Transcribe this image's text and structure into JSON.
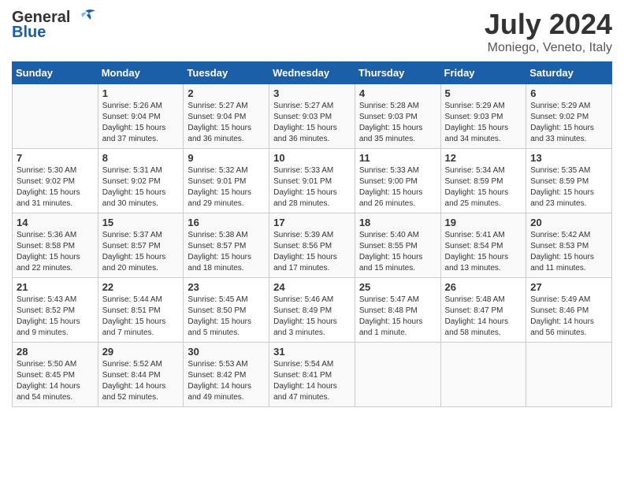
{
  "header": {
    "logo_general": "General",
    "logo_blue": "Blue",
    "month": "July 2024",
    "location": "Moniego, Veneto, Italy"
  },
  "weekdays": [
    "Sunday",
    "Monday",
    "Tuesday",
    "Wednesday",
    "Thursday",
    "Friday",
    "Saturday"
  ],
  "weeks": [
    [
      {
        "day": "",
        "sunrise": "",
        "sunset": "",
        "daylight": ""
      },
      {
        "day": "1",
        "sunrise": "Sunrise: 5:26 AM",
        "sunset": "Sunset: 9:04 PM",
        "daylight": "Daylight: 15 hours and 37 minutes."
      },
      {
        "day": "2",
        "sunrise": "Sunrise: 5:27 AM",
        "sunset": "Sunset: 9:04 PM",
        "daylight": "Daylight: 15 hours and 36 minutes."
      },
      {
        "day": "3",
        "sunrise": "Sunrise: 5:27 AM",
        "sunset": "Sunset: 9:03 PM",
        "daylight": "Daylight: 15 hours and 36 minutes."
      },
      {
        "day": "4",
        "sunrise": "Sunrise: 5:28 AM",
        "sunset": "Sunset: 9:03 PM",
        "daylight": "Daylight: 15 hours and 35 minutes."
      },
      {
        "day": "5",
        "sunrise": "Sunrise: 5:29 AM",
        "sunset": "Sunset: 9:03 PM",
        "daylight": "Daylight: 15 hours and 34 minutes."
      },
      {
        "day": "6",
        "sunrise": "Sunrise: 5:29 AM",
        "sunset": "Sunset: 9:02 PM",
        "daylight": "Daylight: 15 hours and 33 minutes."
      }
    ],
    [
      {
        "day": "7",
        "sunrise": "Sunrise: 5:30 AM",
        "sunset": "Sunset: 9:02 PM",
        "daylight": "Daylight: 15 hours and 31 minutes."
      },
      {
        "day": "8",
        "sunrise": "Sunrise: 5:31 AM",
        "sunset": "Sunset: 9:02 PM",
        "daylight": "Daylight: 15 hours and 30 minutes."
      },
      {
        "day": "9",
        "sunrise": "Sunrise: 5:32 AM",
        "sunset": "Sunset: 9:01 PM",
        "daylight": "Daylight: 15 hours and 29 minutes."
      },
      {
        "day": "10",
        "sunrise": "Sunrise: 5:33 AM",
        "sunset": "Sunset: 9:01 PM",
        "daylight": "Daylight: 15 hours and 28 minutes."
      },
      {
        "day": "11",
        "sunrise": "Sunrise: 5:33 AM",
        "sunset": "Sunset: 9:00 PM",
        "daylight": "Daylight: 15 hours and 26 minutes."
      },
      {
        "day": "12",
        "sunrise": "Sunrise: 5:34 AM",
        "sunset": "Sunset: 8:59 PM",
        "daylight": "Daylight: 15 hours and 25 minutes."
      },
      {
        "day": "13",
        "sunrise": "Sunrise: 5:35 AM",
        "sunset": "Sunset: 8:59 PM",
        "daylight": "Daylight: 15 hours and 23 minutes."
      }
    ],
    [
      {
        "day": "14",
        "sunrise": "Sunrise: 5:36 AM",
        "sunset": "Sunset: 8:58 PM",
        "daylight": "Daylight: 15 hours and 22 minutes."
      },
      {
        "day": "15",
        "sunrise": "Sunrise: 5:37 AM",
        "sunset": "Sunset: 8:57 PM",
        "daylight": "Daylight: 15 hours and 20 minutes."
      },
      {
        "day": "16",
        "sunrise": "Sunrise: 5:38 AM",
        "sunset": "Sunset: 8:57 PM",
        "daylight": "Daylight: 15 hours and 18 minutes."
      },
      {
        "day": "17",
        "sunrise": "Sunrise: 5:39 AM",
        "sunset": "Sunset: 8:56 PM",
        "daylight": "Daylight: 15 hours and 17 minutes."
      },
      {
        "day": "18",
        "sunrise": "Sunrise: 5:40 AM",
        "sunset": "Sunset: 8:55 PM",
        "daylight": "Daylight: 15 hours and 15 minutes."
      },
      {
        "day": "19",
        "sunrise": "Sunrise: 5:41 AM",
        "sunset": "Sunset: 8:54 PM",
        "daylight": "Daylight: 15 hours and 13 minutes."
      },
      {
        "day": "20",
        "sunrise": "Sunrise: 5:42 AM",
        "sunset": "Sunset: 8:53 PM",
        "daylight": "Daylight: 15 hours and 11 minutes."
      }
    ],
    [
      {
        "day": "21",
        "sunrise": "Sunrise: 5:43 AM",
        "sunset": "Sunset: 8:52 PM",
        "daylight": "Daylight: 15 hours and 9 minutes."
      },
      {
        "day": "22",
        "sunrise": "Sunrise: 5:44 AM",
        "sunset": "Sunset: 8:51 PM",
        "daylight": "Daylight: 15 hours and 7 minutes."
      },
      {
        "day": "23",
        "sunrise": "Sunrise: 5:45 AM",
        "sunset": "Sunset: 8:50 PM",
        "daylight": "Daylight: 15 hours and 5 minutes."
      },
      {
        "day": "24",
        "sunrise": "Sunrise: 5:46 AM",
        "sunset": "Sunset: 8:49 PM",
        "daylight": "Daylight: 15 hours and 3 minutes."
      },
      {
        "day": "25",
        "sunrise": "Sunrise: 5:47 AM",
        "sunset": "Sunset: 8:48 PM",
        "daylight": "Daylight: 15 hours and 1 minute."
      },
      {
        "day": "26",
        "sunrise": "Sunrise: 5:48 AM",
        "sunset": "Sunset: 8:47 PM",
        "daylight": "Daylight: 14 hours and 58 minutes."
      },
      {
        "day": "27",
        "sunrise": "Sunrise: 5:49 AM",
        "sunset": "Sunset: 8:46 PM",
        "daylight": "Daylight: 14 hours and 56 minutes."
      }
    ],
    [
      {
        "day": "28",
        "sunrise": "Sunrise: 5:50 AM",
        "sunset": "Sunset: 8:45 PM",
        "daylight": "Daylight: 14 hours and 54 minutes."
      },
      {
        "day": "29",
        "sunrise": "Sunrise: 5:52 AM",
        "sunset": "Sunset: 8:44 PM",
        "daylight": "Daylight: 14 hours and 52 minutes."
      },
      {
        "day": "30",
        "sunrise": "Sunrise: 5:53 AM",
        "sunset": "Sunset: 8:42 PM",
        "daylight": "Daylight: 14 hours and 49 minutes."
      },
      {
        "day": "31",
        "sunrise": "Sunrise: 5:54 AM",
        "sunset": "Sunset: 8:41 PM",
        "daylight": "Daylight: 14 hours and 47 minutes."
      },
      {
        "day": "",
        "sunrise": "",
        "sunset": "",
        "daylight": ""
      },
      {
        "day": "",
        "sunrise": "",
        "sunset": "",
        "daylight": ""
      },
      {
        "day": "",
        "sunrise": "",
        "sunset": "",
        "daylight": ""
      }
    ]
  ]
}
